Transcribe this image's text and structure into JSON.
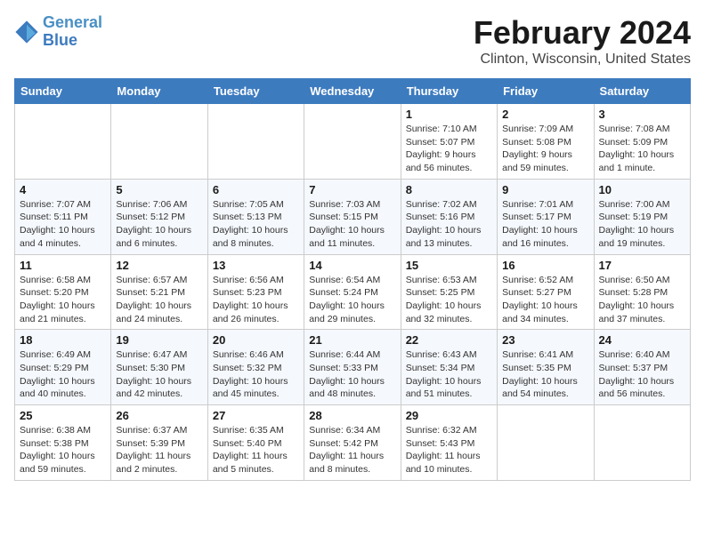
{
  "logo": {
    "line1": "General",
    "line2": "Blue"
  },
  "title": "February 2024",
  "location": "Clinton, Wisconsin, United States",
  "weekdays": [
    "Sunday",
    "Monday",
    "Tuesday",
    "Wednesday",
    "Thursday",
    "Friday",
    "Saturday"
  ],
  "weeks": [
    [
      {
        "day": "",
        "info": ""
      },
      {
        "day": "",
        "info": ""
      },
      {
        "day": "",
        "info": ""
      },
      {
        "day": "",
        "info": ""
      },
      {
        "day": "1",
        "info": "Sunrise: 7:10 AM\nSunset: 5:07 PM\nDaylight: 9 hours\nand 56 minutes."
      },
      {
        "day": "2",
        "info": "Sunrise: 7:09 AM\nSunset: 5:08 PM\nDaylight: 9 hours\nand 59 minutes."
      },
      {
        "day": "3",
        "info": "Sunrise: 7:08 AM\nSunset: 5:09 PM\nDaylight: 10 hours\nand 1 minute."
      }
    ],
    [
      {
        "day": "4",
        "info": "Sunrise: 7:07 AM\nSunset: 5:11 PM\nDaylight: 10 hours\nand 4 minutes."
      },
      {
        "day": "5",
        "info": "Sunrise: 7:06 AM\nSunset: 5:12 PM\nDaylight: 10 hours\nand 6 minutes."
      },
      {
        "day": "6",
        "info": "Sunrise: 7:05 AM\nSunset: 5:13 PM\nDaylight: 10 hours\nand 8 minutes."
      },
      {
        "day": "7",
        "info": "Sunrise: 7:03 AM\nSunset: 5:15 PM\nDaylight: 10 hours\nand 11 minutes."
      },
      {
        "day": "8",
        "info": "Sunrise: 7:02 AM\nSunset: 5:16 PM\nDaylight: 10 hours\nand 13 minutes."
      },
      {
        "day": "9",
        "info": "Sunrise: 7:01 AM\nSunset: 5:17 PM\nDaylight: 10 hours\nand 16 minutes."
      },
      {
        "day": "10",
        "info": "Sunrise: 7:00 AM\nSunset: 5:19 PM\nDaylight: 10 hours\nand 19 minutes."
      }
    ],
    [
      {
        "day": "11",
        "info": "Sunrise: 6:58 AM\nSunset: 5:20 PM\nDaylight: 10 hours\nand 21 minutes."
      },
      {
        "day": "12",
        "info": "Sunrise: 6:57 AM\nSunset: 5:21 PM\nDaylight: 10 hours\nand 24 minutes."
      },
      {
        "day": "13",
        "info": "Sunrise: 6:56 AM\nSunset: 5:23 PM\nDaylight: 10 hours\nand 26 minutes."
      },
      {
        "day": "14",
        "info": "Sunrise: 6:54 AM\nSunset: 5:24 PM\nDaylight: 10 hours\nand 29 minutes."
      },
      {
        "day": "15",
        "info": "Sunrise: 6:53 AM\nSunset: 5:25 PM\nDaylight: 10 hours\nand 32 minutes."
      },
      {
        "day": "16",
        "info": "Sunrise: 6:52 AM\nSunset: 5:27 PM\nDaylight: 10 hours\nand 34 minutes."
      },
      {
        "day": "17",
        "info": "Sunrise: 6:50 AM\nSunset: 5:28 PM\nDaylight: 10 hours\nand 37 minutes."
      }
    ],
    [
      {
        "day": "18",
        "info": "Sunrise: 6:49 AM\nSunset: 5:29 PM\nDaylight: 10 hours\nand 40 minutes."
      },
      {
        "day": "19",
        "info": "Sunrise: 6:47 AM\nSunset: 5:30 PM\nDaylight: 10 hours\nand 42 minutes."
      },
      {
        "day": "20",
        "info": "Sunrise: 6:46 AM\nSunset: 5:32 PM\nDaylight: 10 hours\nand 45 minutes."
      },
      {
        "day": "21",
        "info": "Sunrise: 6:44 AM\nSunset: 5:33 PM\nDaylight: 10 hours\nand 48 minutes."
      },
      {
        "day": "22",
        "info": "Sunrise: 6:43 AM\nSunset: 5:34 PM\nDaylight: 10 hours\nand 51 minutes."
      },
      {
        "day": "23",
        "info": "Sunrise: 6:41 AM\nSunset: 5:35 PM\nDaylight: 10 hours\nand 54 minutes."
      },
      {
        "day": "24",
        "info": "Sunrise: 6:40 AM\nSunset: 5:37 PM\nDaylight: 10 hours\nand 56 minutes."
      }
    ],
    [
      {
        "day": "25",
        "info": "Sunrise: 6:38 AM\nSunset: 5:38 PM\nDaylight: 10 hours\nand 59 minutes."
      },
      {
        "day": "26",
        "info": "Sunrise: 6:37 AM\nSunset: 5:39 PM\nDaylight: 11 hours\nand 2 minutes."
      },
      {
        "day": "27",
        "info": "Sunrise: 6:35 AM\nSunset: 5:40 PM\nDaylight: 11 hours\nand 5 minutes."
      },
      {
        "day": "28",
        "info": "Sunrise: 6:34 AM\nSunset: 5:42 PM\nDaylight: 11 hours\nand 8 minutes."
      },
      {
        "day": "29",
        "info": "Sunrise: 6:32 AM\nSunset: 5:43 PM\nDaylight: 11 hours\nand 10 minutes."
      },
      {
        "day": "",
        "info": ""
      },
      {
        "day": "",
        "info": ""
      }
    ]
  ]
}
